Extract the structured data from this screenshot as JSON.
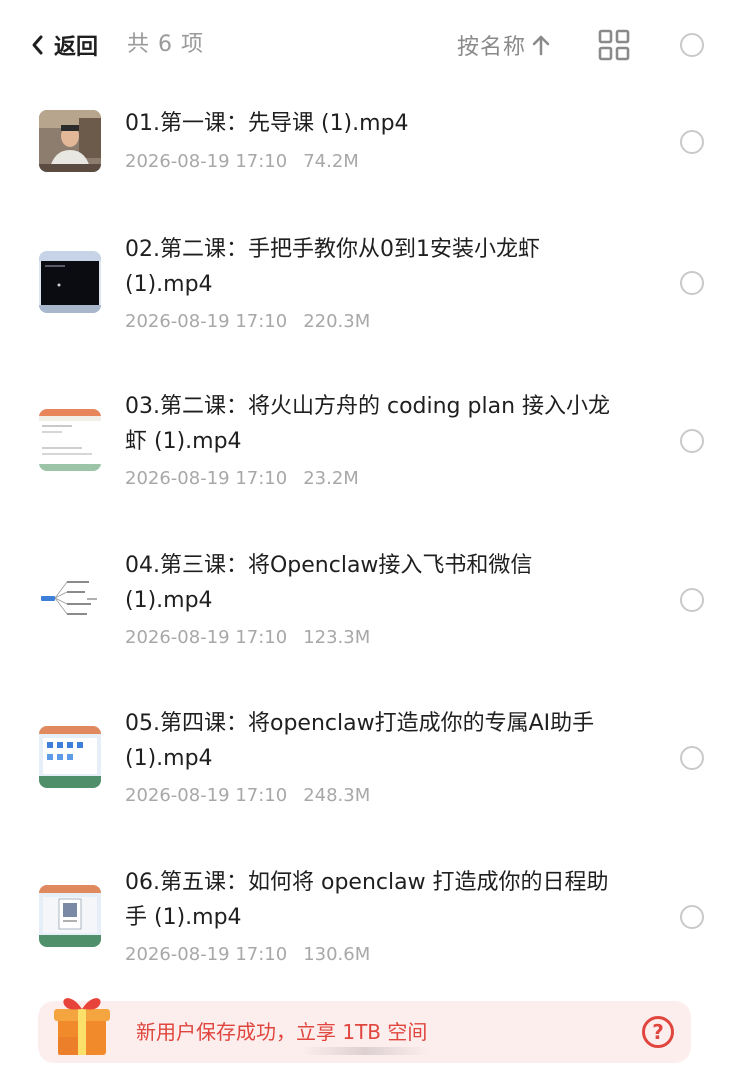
{
  "header": {
    "back_label": "返回",
    "count_text": "共 6 项",
    "sort_label": "按名称",
    "sort_icon": "arrow-up-icon",
    "view_icon": "grid-view-icon"
  },
  "files": [
    {
      "name": "01.第一课：先导课 (1).mp4",
      "date": "2026-08-19 17:10",
      "size": "74.2M",
      "thumb": "person-video"
    },
    {
      "name": "02.第二课：手把手教你从0到1安装小龙虾 (1).mp4",
      "date": "2026-08-19 17:10",
      "size": "220.3M",
      "thumb": "terminal-screen"
    },
    {
      "name": "03.第二课：将火山方舟的 coding plan 接入小龙虾 (1).mp4",
      "date": "2026-08-19 17:10",
      "size": "23.2M",
      "thumb": "web-page"
    },
    {
      "name": "04.第三课：将Openclaw接入飞书和微信 (1).mp4",
      "date": "2026-08-19 17:10",
      "size": "123.3M",
      "thumb": "mind-map"
    },
    {
      "name": "05.第四课：将openclaw打造成你的专属AI助手 (1).mp4",
      "date": "2026-08-19 17:10",
      "size": "248.3M",
      "thumb": "desktop-screen"
    },
    {
      "name": "06.第五课：如何将 openclaw 打造成你的日程助手 (1).mp4",
      "date": "2026-08-19 17:10",
      "size": "130.6M",
      "thumb": "desktop-window"
    }
  ],
  "banner": {
    "text": "新用户保存成功，立享 1TB 空间",
    "icon": "gift-icon",
    "help_icon": "help-icon"
  },
  "colors": {
    "accent": "#e0453e",
    "banner_bg": "#fdeeee",
    "muted": "#a8a8a8"
  }
}
